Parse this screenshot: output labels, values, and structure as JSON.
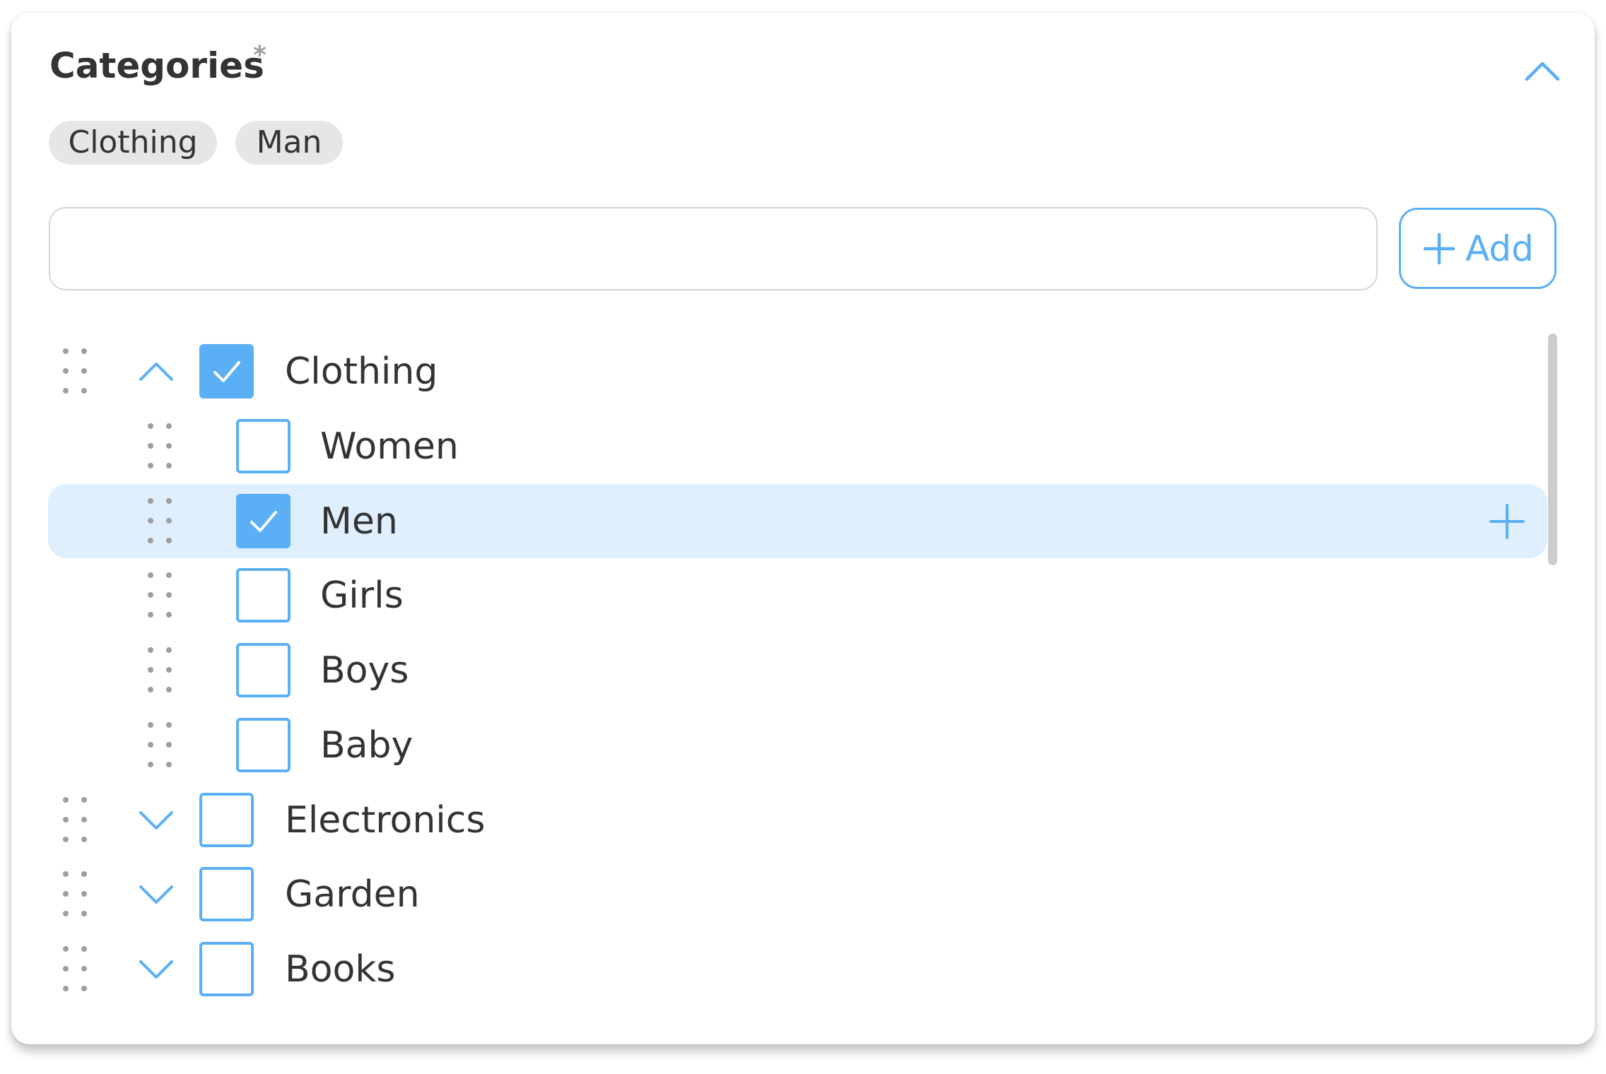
{
  "header": {
    "title": "Categories",
    "required_marker": "*",
    "collapse_icon": "chevron-up-icon"
  },
  "selected_chips": [
    {
      "label": "Clothing"
    },
    {
      "label": "Man"
    }
  ],
  "new_category": {
    "value": "",
    "placeholder": "",
    "add_label": "Add",
    "add_icon": "plus-icon"
  },
  "tree": [
    {
      "label": "Clothing",
      "level": 0,
      "expanded": true,
      "checked": true,
      "highlighted": false
    },
    {
      "label": "Women",
      "level": 1,
      "checked": false,
      "highlighted": false
    },
    {
      "label": "Men",
      "level": 1,
      "checked": true,
      "highlighted": true
    },
    {
      "label": "Girls",
      "level": 1,
      "checked": false,
      "highlighted": false
    },
    {
      "label": "Boys",
      "level": 1,
      "checked": false,
      "highlighted": false
    },
    {
      "label": "Baby",
      "level": 1,
      "checked": false,
      "highlighted": false
    },
    {
      "label": "Electronics",
      "level": 0,
      "expanded": false,
      "checked": false,
      "highlighted": false
    },
    {
      "label": "Garden",
      "level": 0,
      "expanded": false,
      "checked": false,
      "highlighted": false
    },
    {
      "label": "Books",
      "level": 0,
      "expanded": false,
      "checked": false,
      "highlighted": false
    }
  ],
  "colors": {
    "accent": "#5aaff5",
    "highlight_row": "#dfeffd",
    "chip_bg": "#e6e6e6",
    "text": "#333333",
    "muted": "#9e9e9e"
  }
}
